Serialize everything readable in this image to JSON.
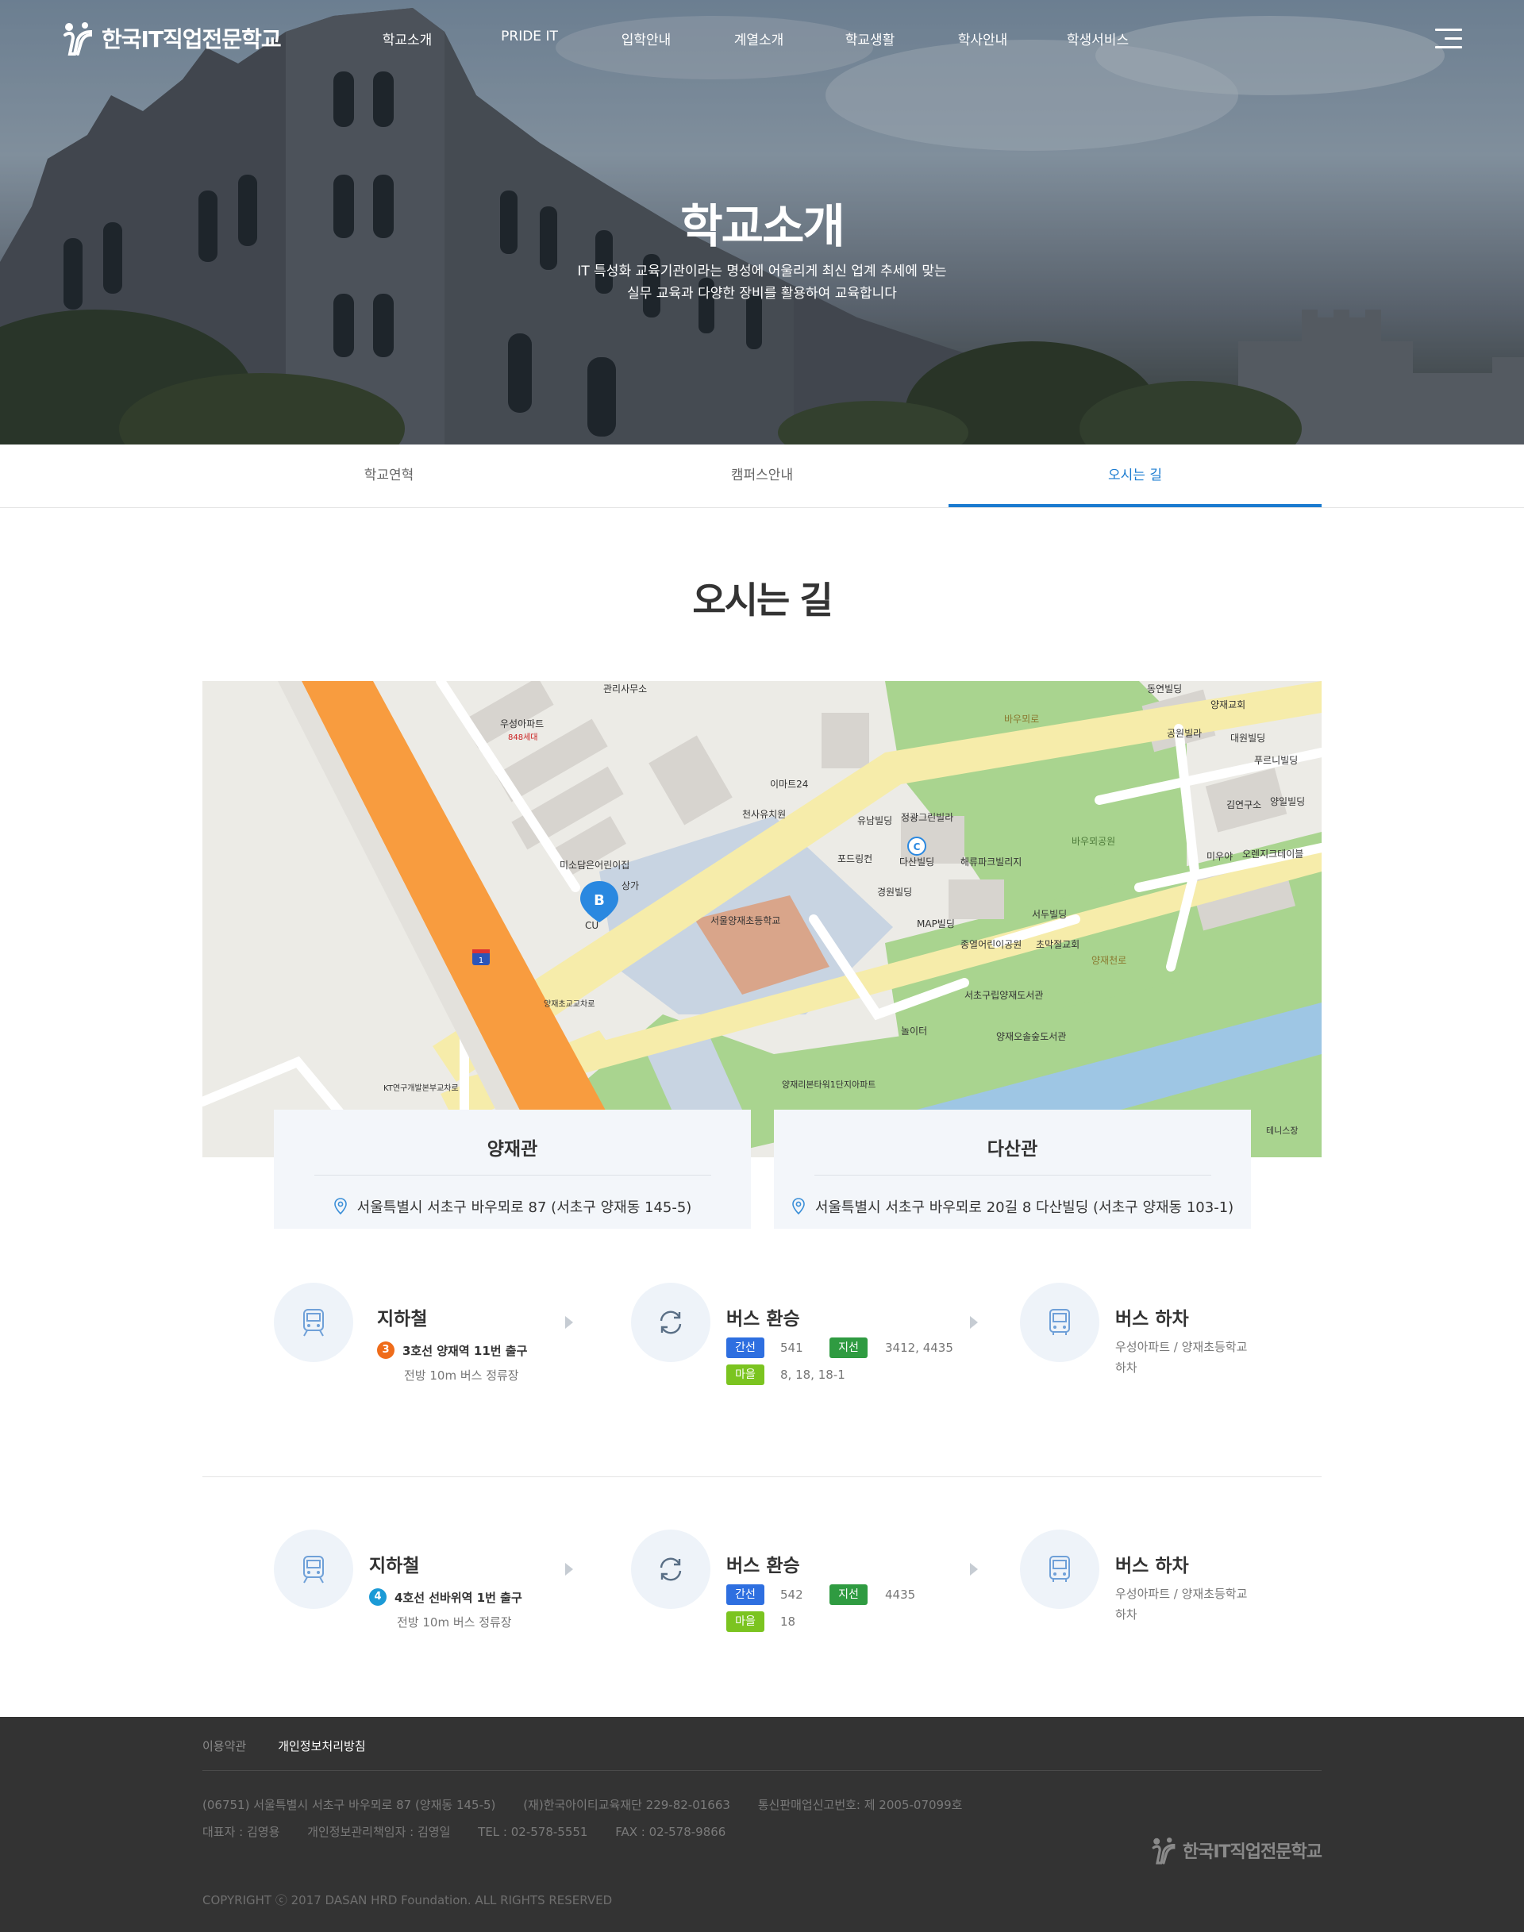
{
  "header": {
    "logo_text": "한국IT직업전문학교",
    "nav": [
      "학교소개",
      "PRIDE IT",
      "입학안내",
      "계열소개",
      "학교생활",
      "학사안내",
      "학생서비스"
    ]
  },
  "hero": {
    "title": "학교소개",
    "desc_line1": "IT 특성화 교육기관이라는 명성에 어울리게 최신 업계 추세에 맞는",
    "desc_line2": "실무 교육과 다양한 장비를 활용하여 교육합니다"
  },
  "tabs": [
    {
      "label": "학교연혁",
      "active": false
    },
    {
      "label": "캠퍼스안내",
      "active": false
    },
    {
      "label": "오시는 길",
      "active": true
    }
  ],
  "page_title": "오시는 길",
  "map": {
    "labels": {
      "apt": "우성아파트",
      "apt_units": "848세대",
      "office": "관리사무소",
      "emart": "이마트24",
      "cheonsa": "천사유치원",
      "yunap": "유남빌딩",
      "jeonggwang": "정광그린빌라",
      "dasan": "다산빌딩",
      "ford": "포드링컨",
      "haeryu": "해류파크빌리지",
      "gyeongwon": "경원빌딩",
      "map_bldg": "MAP빌딩",
      "seodu": "서두빌딩",
      "school": "서울양재초등학교",
      "park": "바우뫼공원",
      "library": "서초구립양재도서관",
      "culture": "양재오솔숲도서관",
      "playground": "놀이터",
      "misodamun": "미소담은어린이집",
      "sanga": "상가",
      "cu": "CU",
      "yangjae_cross": "양재초교교차로",
      "kt": "KT연구개발본부교차로",
      "tennis": "테니스장",
      "road_baumoe": "바우뫼로",
      "road_yangjae": "양재천로",
      "dongyeon": "동연빌딩",
      "yangjae_church": "양재교회",
      "gongwon": "공원빌라",
      "daewon": "대원빌딩",
      "pureuni": "푸르니빌딩",
      "gimyeon": "김연구소",
      "yangil": "양일빌딩",
      "miuya": "미우야",
      "orange": "오렌지크테이블",
      "chomak": "초막절교회",
      "jongyeol": "종열어린이공원",
      "yangjae_rib": "양재리본타워1단지아파트",
      "marker_b": "B",
      "marker_c": "C",
      "route_no": "1"
    }
  },
  "addresses": [
    {
      "name": "양재관",
      "address": "서울특별시 서초구 바우뫼로 87 (서초구 양재동 145-5)"
    },
    {
      "name": "다산관",
      "address": "서울특별시 서초구 바우뫼로 20길 8 다산빌딩 (서초구 양재동 103-1)"
    }
  ],
  "routes": [
    {
      "subway": {
        "title": "지하철",
        "line_no": "3",
        "station": "3호선 양재역 11번 출구",
        "note": "전방 10m 버스 정류장"
      },
      "transfer": {
        "title": "버스 환승",
        "trunk_tag": "간선",
        "trunk": "541",
        "branch_tag": "지선",
        "branch": "3412, 4435",
        "village_tag": "마을",
        "village": "8, 18, 18-1"
      },
      "getoff": {
        "title": "버스 하차",
        "line1": "우성아파트 / 양재초등학교",
        "line2": "하차"
      }
    },
    {
      "subway": {
        "title": "지하철",
        "line_no": "4",
        "station": "4호선 선바위역 1번 출구",
        "note": "전방 10m 버스 정류장"
      },
      "transfer": {
        "title": "버스 환승",
        "trunk_tag": "간선",
        "trunk": "542",
        "branch_tag": "지선",
        "branch": "4435",
        "village_tag": "마을",
        "village": "18"
      },
      "getoff": {
        "title": "버스 하차",
        "line1": "우성아파트 / 양재초등학교",
        "line2": "하차"
      }
    }
  ],
  "footer": {
    "terms": "이용약관",
    "privacy": "개인정보처리방침",
    "address": "(06751) 서울특별시 서초구 바우뫼로 87 (양재동 145-5)",
    "foundation": "(재)한국아이티교육재단 229-82-01663",
    "sales_reg": "통신판매업신고번호: 제 2005-07099호",
    "ceo": "대표자 : 김영용",
    "privacy_officer": "개인정보관리책임자 : 김영일",
    "tel": "TEL : 02-578-5551",
    "fax": "FAX : 02-578-9866",
    "copyright": "COPYRIGHT ⓒ 2017 DASAN HRD Foundation. ALL RIGHTS RESERVED",
    "logo_text": "한국IT직업전문학교"
  }
}
